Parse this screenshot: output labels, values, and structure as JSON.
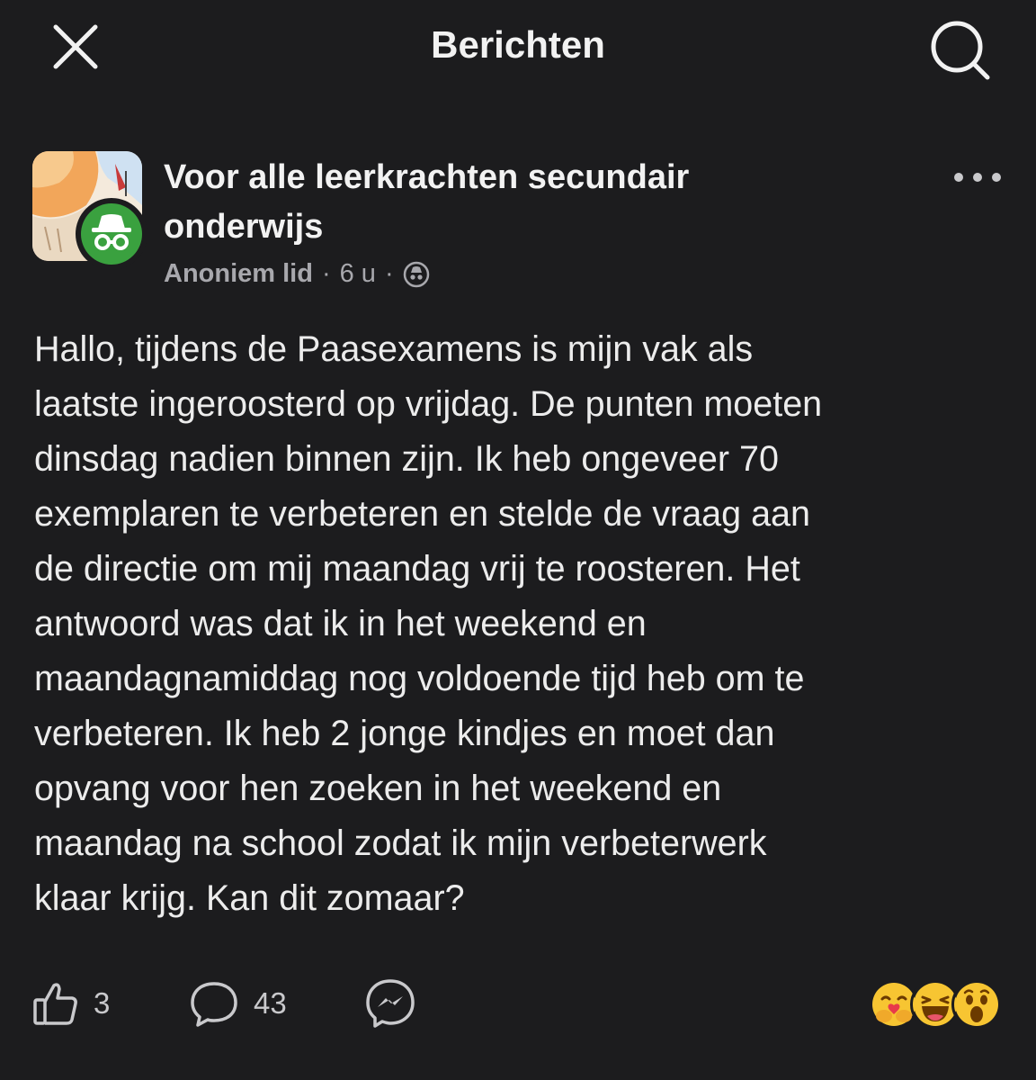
{
  "header": {
    "title": "Berichten",
    "close_icon": "close-icon",
    "search_icon": "search-icon"
  },
  "post": {
    "group_name": "Voor alle leerkrachten secundair onderwijs",
    "author": "Anoniem lid",
    "separator": "·",
    "time": "6 u",
    "privacy_icon": "anonymous-icon",
    "more_icon": "more-dots-icon",
    "body": "Hallo, tijdens de Paasexamens is mijn vak als\nlaatste ingeroosterd op vrijdag. De punten moeten\ndinsdag nadien binnen zijn. Ik heb ongeveer 70\nexemplaren te verbeteren en stelde de vraag aan\nde directie om mij maandag vrij te roosteren. Het\nantwoord was dat ik in het weekend en\nmaandagnamiddag nog voldoende tijd heb om te\nverbeteren. Ik heb 2 jonge kindjes en moet dan\nopvang voor hen zoeken in het weekend en\nmaandag na school zodat ik mijn verbeterwerk\nklaar krijg. Kan dit zomaar?"
  },
  "actions": {
    "like_count": "3",
    "comment_count": "43",
    "like_icon": "thumbs-up-icon",
    "comment_icon": "comment-icon",
    "share_icon": "messenger-icon",
    "reactions": [
      "care-emoji",
      "haha-emoji",
      "wow-emoji"
    ]
  },
  "colors": {
    "background": "#1c1c1e",
    "text": "#ececec",
    "muted": "#a8a8ad",
    "badge_green": "#3aa13f",
    "emoji_yellow": "#f7c532"
  }
}
